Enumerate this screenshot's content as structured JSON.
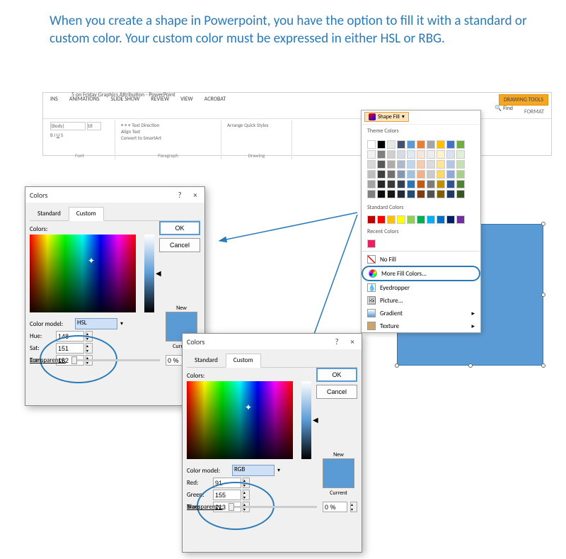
{
  "instruction": "When you create a shape in Powerpoint, you have the option to fill it with a standard or custom color.  Your custom color must be expressed in either HSL or RBG.",
  "ppt": {
    "title": "5 on Friday Graphics Attribution - PowerPoint",
    "tabs": [
      "INS",
      "ANIMATIONS",
      "SLIDE SHOW",
      "REVIEW",
      "VIEW",
      "ACROBAT"
    ],
    "drawing_tools": "DRAWING TOOLS",
    "format_tab": "FORMAT",
    "font_group": "Font",
    "paragraph_group": "Paragraph",
    "drawing_group": "Drawing",
    "font_name": "(Body)",
    "font_size": "18",
    "text_direction": "Text Direction",
    "align_text": "Align Text",
    "convert_smartart": "Convert to SmartArt",
    "arrange": "Arrange",
    "quick_styles": "Quick Styles",
    "find": "Find"
  },
  "shapefill": {
    "button": "Shape Fill",
    "theme_colors": "Theme Colors",
    "standard_colors": "Standard Colors",
    "recent_colors": "Recent Colors",
    "no_fill": "No Fill",
    "more_colors": "More Fill Colors...",
    "eyedropper": "Eyedropper",
    "picture": "Picture...",
    "gradient": "Gradient",
    "texture": "Texture",
    "theme_grid": [
      "#ffffff",
      "#000000",
      "#e7e6e6",
      "#44546a",
      "#5b9bd5",
      "#ed7d31",
      "#a5a5a5",
      "#ffc000",
      "#4472c4",
      "#70ad47",
      "#f2f2f2",
      "#7f7f7f",
      "#d0cece",
      "#d6dce4",
      "#deebf6",
      "#fbe5d5",
      "#ededed",
      "#fff2cc",
      "#d9e2f3",
      "#e2efd9",
      "#d8d8d8",
      "#595959",
      "#aeabab",
      "#adb9ca",
      "#bdd7ee",
      "#f7cbac",
      "#dbdbdb",
      "#fee599",
      "#b4c6e7",
      "#c5e0b3",
      "#bfbfbf",
      "#3f3f3f",
      "#757070",
      "#8496b0",
      "#9cc3e5",
      "#f4b183",
      "#c9c9c9",
      "#ffd965",
      "#8eaadb",
      "#a8d08d",
      "#a5a5a5",
      "#262626",
      "#3a3838",
      "#323f4f",
      "#2e75b5",
      "#c55a11",
      "#7b7b7b",
      "#bf9000",
      "#2f5496",
      "#538135",
      "#7f7f7f",
      "#0c0c0c",
      "#171616",
      "#222a35",
      "#1e4e79",
      "#833c0b",
      "#525252",
      "#7f6000",
      "#1f3864",
      "#375623"
    ],
    "standard_row": [
      "#c00000",
      "#ff0000",
      "#ffc000",
      "#ffff00",
      "#92d050",
      "#00b050",
      "#00b0f0",
      "#0070c0",
      "#002060",
      "#7030a0"
    ],
    "recent_row": [
      "#e91e63"
    ]
  },
  "dlg": {
    "title": "Colors",
    "help": "?",
    "close": "×",
    "tab_standard": "Standard",
    "tab_custom": "Custom",
    "ok": "OK",
    "cancel": "Cancel",
    "colors": "Colors:",
    "color_model": "Color model:",
    "transparency": "Transparency:",
    "trans_value": "0 %",
    "new": "New",
    "current": "Current"
  },
  "hsl": {
    "model": "HSL",
    "hue_label": "Hue:",
    "sat_label": "Sat:",
    "lum_label": "Lum:",
    "hue": "148",
    "sat": "151",
    "lum": "152"
  },
  "rgb": {
    "model": "RGB",
    "red_label": "Red:",
    "green_label": "Green:",
    "blue_label": "Blue:",
    "red": "91",
    "green": "155",
    "blue": "213"
  }
}
